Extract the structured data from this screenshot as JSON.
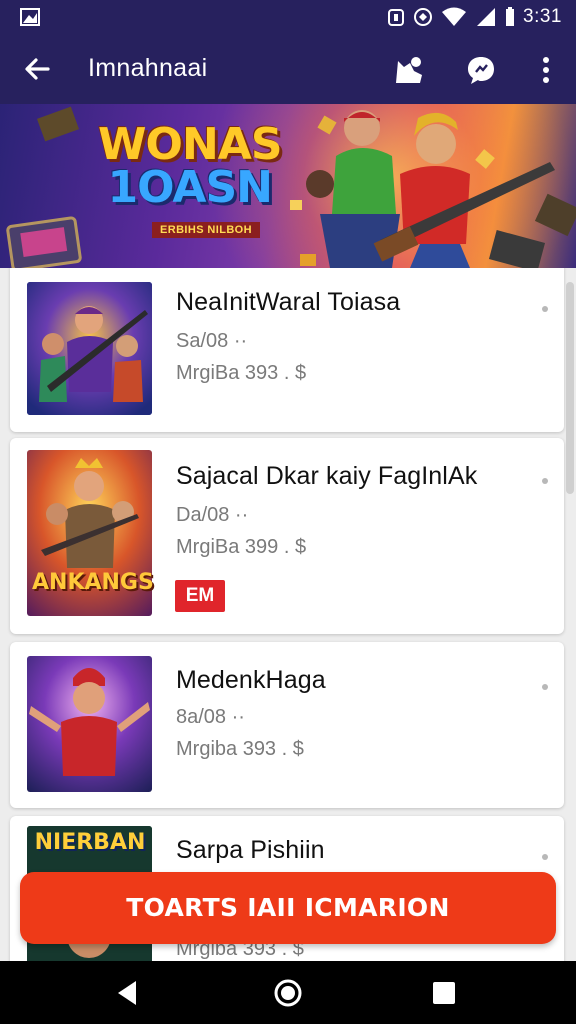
{
  "status_bar": {
    "time": "3:31",
    "icons": [
      "notification-icon",
      "alarm-icon",
      "vibrate-icon",
      "wifi-icon",
      "signal-icon",
      "battery-icon"
    ]
  },
  "app_bar": {
    "title": "Imnahnaai",
    "actions": [
      "back-icon",
      "profile-icon",
      "chat-icon",
      "more-vert-icon"
    ]
  },
  "banner": {
    "title_line1": "WONAS",
    "title_line2": "1OASN",
    "subtitle": "ERBIHS NILBOH"
  },
  "games": [
    {
      "name": "NeaInitWaral Toiasa",
      "meta1": "Sa/08 ··",
      "meta2": "MrgiBa 393 . $",
      "badge": ""
    },
    {
      "name": "Sajacal Dkar kaiy FagInlAk",
      "meta1": "Da/08 ··",
      "meta2": "MrgiBa 399 . $",
      "badge": "EM",
      "thumb_caption": "ANKANGS"
    },
    {
      "name": "MedenkHaga",
      "meta1": "8a/08 ··",
      "meta2": "Mrgiba 393 . $",
      "badge": ""
    },
    {
      "name": "Sarpa Pishiin",
      "meta1": "",
      "meta2": "Mrgiba 393 . $",
      "badge": "",
      "thumb_caption": "NIERBAN"
    }
  ],
  "cta": {
    "label": "TOARTS IAII ICMARION"
  },
  "colors": {
    "appbar": "#27215e",
    "accent": "#ee3a18",
    "badge": "#e0252b"
  },
  "nav": [
    "back-nav-icon",
    "home-nav-icon",
    "recents-nav-icon"
  ]
}
